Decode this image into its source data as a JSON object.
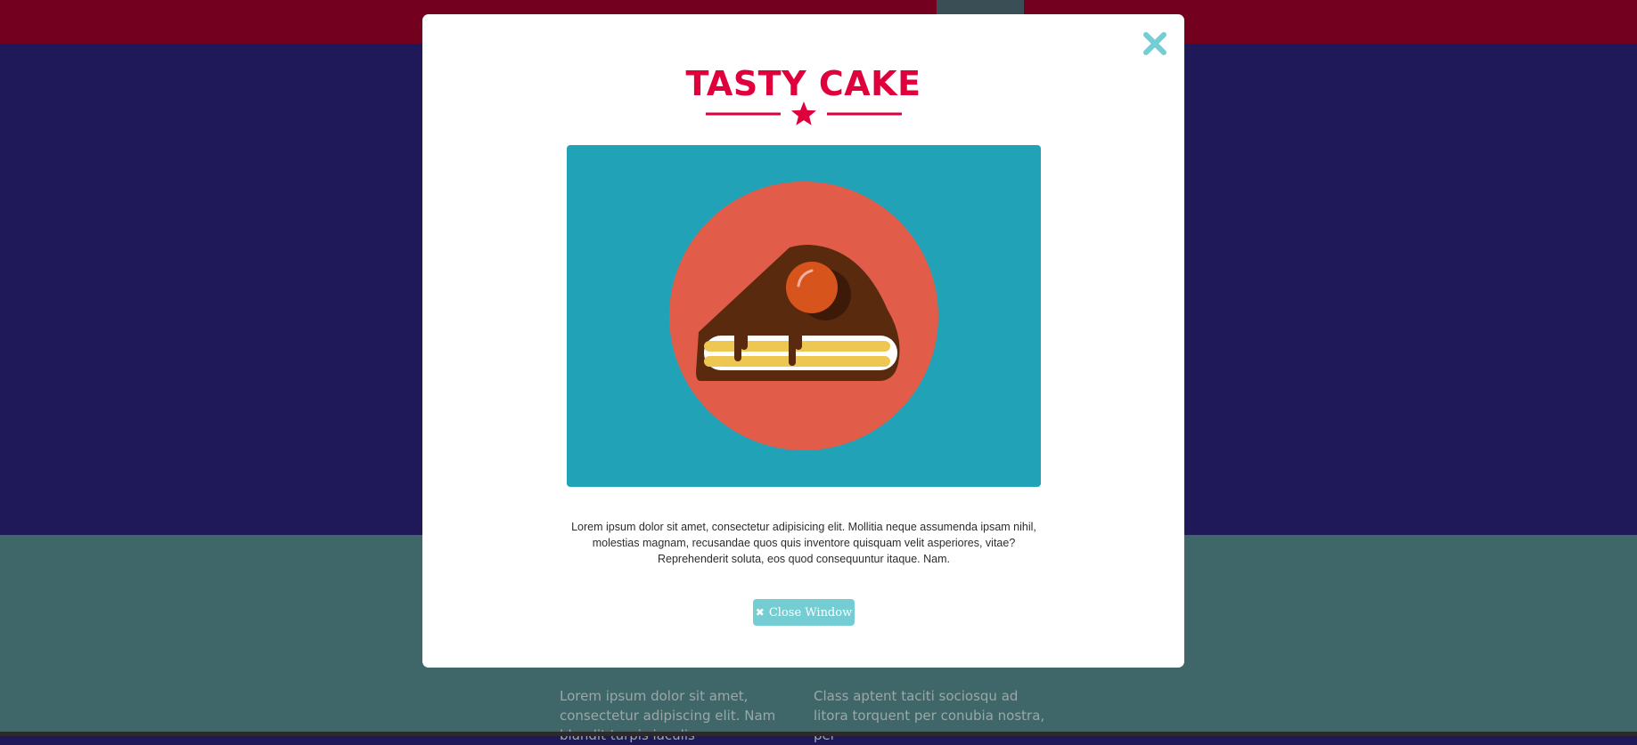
{
  "background": {
    "nav_brand": "...",
    "columns": [
      {
        "text": "Lorem ipsum dolor sit amet, consectetur adipiscing elit. Nam blandit turpis iaculis"
      },
      {
        "text": "Class aptent taciti sociosqu ad litora torquent per conubia nostra, per"
      }
    ]
  },
  "modal": {
    "title": "TASTY CAKE",
    "divider_icon": "star-icon",
    "image_icon": "cake-slice-icon",
    "description": "Lorem ipsum dolor sit amet, consectetur adipisicing elit. Mollitia neque assumenda ipsam nihil, molestias magnam, recusandae quos quis inventore quisquam velit asperiores, vitae? Reprehenderit soluta, eos quod consequuntur itaque. Nam.",
    "close_button_label": "Close Window",
    "close_button_icon": "close-icon",
    "close_x_icon": "close-icon"
  },
  "colors": {
    "accent": "#e0003b",
    "teal": "#21a2b6",
    "button": "#74cdd3",
    "close_x": "#74cdd3"
  }
}
